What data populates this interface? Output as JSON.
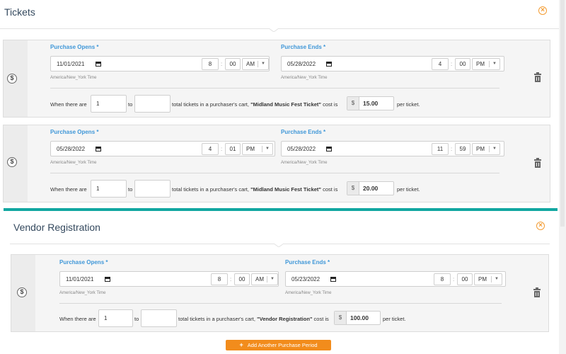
{
  "tickets": {
    "title": "Tickets",
    "periods": [
      {
        "opens_label": "Purchase Opens *",
        "opens_date": "11/01/2021",
        "opens_hour": "8",
        "opens_minute": "00",
        "opens_ampm": "AM",
        "opens_tz": "America/New_York Time",
        "ends_label": "Purchase Ends *",
        "ends_date": "05/28/2022",
        "ends_hour": "4",
        "ends_minute": "00",
        "ends_ampm": "PM",
        "ends_tz": "America/New_York Time",
        "when_text": "When there are",
        "from_value": "1",
        "from_placeholder": "",
        "to_text": "to",
        "to_value": "",
        "cart_text": "total tickets in a purchaser's cart,",
        "ticket_name": "\"Midland Music Fest Ticket\"",
        "cost_is": "cost is",
        "currency": "$",
        "cost": "15.00",
        "per_ticket": "per ticket."
      },
      {
        "opens_label": "Purchase Opens *",
        "opens_date": "05/28/2022",
        "opens_hour": "4",
        "opens_minute": "01",
        "opens_ampm": "PM",
        "opens_tz": "America/New_York Time",
        "ends_label": "Purchase Ends *",
        "ends_date": "05/28/2022",
        "ends_hour": "11",
        "ends_minute": "59",
        "ends_ampm": "PM",
        "ends_tz": "America/New_York Time",
        "when_text": "When there are",
        "from_value": "1",
        "to_text": "to",
        "to_value": "",
        "cart_text": "total tickets in a purchaser's cart,",
        "ticket_name": "\"Midland Music Fest Ticket\"",
        "cost_is": "cost is",
        "currency": "$",
        "cost": "20.00",
        "per_ticket": "per ticket."
      }
    ]
  },
  "vendor": {
    "title": "Vendor Registration",
    "periods": [
      {
        "opens_label": "Purchase Opens *",
        "opens_date": "11/01/2021",
        "opens_hour": "8",
        "opens_minute": "00",
        "opens_ampm": "AM",
        "opens_tz": "America/New_York Time",
        "ends_label": "Purchase Ends *",
        "ends_date": "05/23/2022",
        "ends_hour": "8",
        "ends_minute": "00",
        "ends_ampm": "PM",
        "ends_tz": "America/New_York Time",
        "when_text": "When there are",
        "from_value": "1",
        "to_text": "to",
        "to_value": "",
        "cart_text": "total tickets in a purchaser's cart,",
        "ticket_name": "\"Vendor Registration\"",
        "cost_is": "cost is",
        "currency": "$",
        "cost": "100.00",
        "per_ticket": "per ticket."
      }
    ],
    "add_button_label": "Add Another Purchase Period"
  },
  "icons": {
    "close": "close-circle-icon",
    "dollar": "dollar-circle-icon",
    "trash": "trash-icon",
    "calendar": "calendar-icon",
    "chevron": "chevron-down-icon",
    "plus": "plus-icon"
  },
  "colors": {
    "accent_orange": "#f39c33",
    "label_blue": "#3f97d8",
    "teal": "#11a7a1",
    "button_orange": "#f28c1c"
  }
}
